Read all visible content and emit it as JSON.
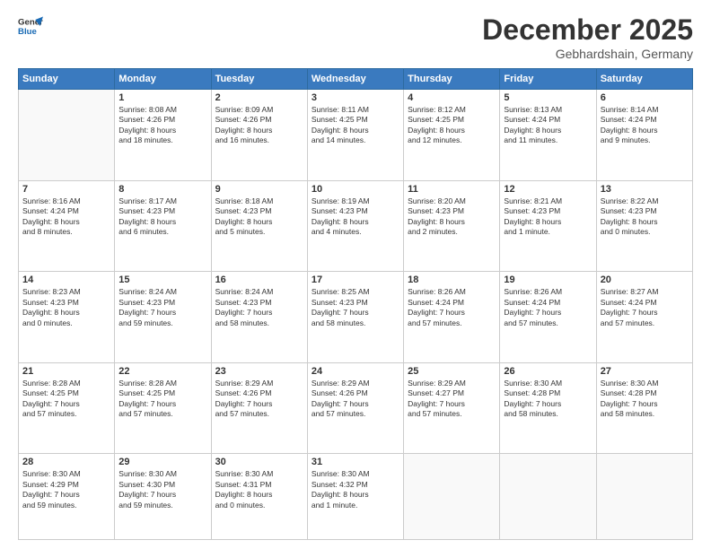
{
  "header": {
    "logo_line1": "General",
    "logo_line2": "Blue",
    "month": "December 2025",
    "location": "Gebhardshain, Germany"
  },
  "weekdays": [
    "Sunday",
    "Monday",
    "Tuesday",
    "Wednesday",
    "Thursday",
    "Friday",
    "Saturday"
  ],
  "weeks": [
    [
      {
        "day": "",
        "info": ""
      },
      {
        "day": "1",
        "info": "Sunrise: 8:08 AM\nSunset: 4:26 PM\nDaylight: 8 hours\nand 18 minutes."
      },
      {
        "day": "2",
        "info": "Sunrise: 8:09 AM\nSunset: 4:26 PM\nDaylight: 8 hours\nand 16 minutes."
      },
      {
        "day": "3",
        "info": "Sunrise: 8:11 AM\nSunset: 4:25 PM\nDaylight: 8 hours\nand 14 minutes."
      },
      {
        "day": "4",
        "info": "Sunrise: 8:12 AM\nSunset: 4:25 PM\nDaylight: 8 hours\nand 12 minutes."
      },
      {
        "day": "5",
        "info": "Sunrise: 8:13 AM\nSunset: 4:24 PM\nDaylight: 8 hours\nand 11 minutes."
      },
      {
        "day": "6",
        "info": "Sunrise: 8:14 AM\nSunset: 4:24 PM\nDaylight: 8 hours\nand 9 minutes."
      }
    ],
    [
      {
        "day": "7",
        "info": "Sunrise: 8:16 AM\nSunset: 4:24 PM\nDaylight: 8 hours\nand 8 minutes."
      },
      {
        "day": "8",
        "info": "Sunrise: 8:17 AM\nSunset: 4:23 PM\nDaylight: 8 hours\nand 6 minutes."
      },
      {
        "day": "9",
        "info": "Sunrise: 8:18 AM\nSunset: 4:23 PM\nDaylight: 8 hours\nand 5 minutes."
      },
      {
        "day": "10",
        "info": "Sunrise: 8:19 AM\nSunset: 4:23 PM\nDaylight: 8 hours\nand 4 minutes."
      },
      {
        "day": "11",
        "info": "Sunrise: 8:20 AM\nSunset: 4:23 PM\nDaylight: 8 hours\nand 2 minutes."
      },
      {
        "day": "12",
        "info": "Sunrise: 8:21 AM\nSunset: 4:23 PM\nDaylight: 8 hours\nand 1 minute."
      },
      {
        "day": "13",
        "info": "Sunrise: 8:22 AM\nSunset: 4:23 PM\nDaylight: 8 hours\nand 0 minutes."
      }
    ],
    [
      {
        "day": "14",
        "info": "Sunrise: 8:23 AM\nSunset: 4:23 PM\nDaylight: 8 hours\nand 0 minutes."
      },
      {
        "day": "15",
        "info": "Sunrise: 8:24 AM\nSunset: 4:23 PM\nDaylight: 7 hours\nand 59 minutes."
      },
      {
        "day": "16",
        "info": "Sunrise: 8:24 AM\nSunset: 4:23 PM\nDaylight: 7 hours\nand 58 minutes."
      },
      {
        "day": "17",
        "info": "Sunrise: 8:25 AM\nSunset: 4:23 PM\nDaylight: 7 hours\nand 58 minutes."
      },
      {
        "day": "18",
        "info": "Sunrise: 8:26 AM\nSunset: 4:24 PM\nDaylight: 7 hours\nand 57 minutes."
      },
      {
        "day": "19",
        "info": "Sunrise: 8:26 AM\nSunset: 4:24 PM\nDaylight: 7 hours\nand 57 minutes."
      },
      {
        "day": "20",
        "info": "Sunrise: 8:27 AM\nSunset: 4:24 PM\nDaylight: 7 hours\nand 57 minutes."
      }
    ],
    [
      {
        "day": "21",
        "info": "Sunrise: 8:28 AM\nSunset: 4:25 PM\nDaylight: 7 hours\nand 57 minutes."
      },
      {
        "day": "22",
        "info": "Sunrise: 8:28 AM\nSunset: 4:25 PM\nDaylight: 7 hours\nand 57 minutes."
      },
      {
        "day": "23",
        "info": "Sunrise: 8:29 AM\nSunset: 4:26 PM\nDaylight: 7 hours\nand 57 minutes."
      },
      {
        "day": "24",
        "info": "Sunrise: 8:29 AM\nSunset: 4:26 PM\nDaylight: 7 hours\nand 57 minutes."
      },
      {
        "day": "25",
        "info": "Sunrise: 8:29 AM\nSunset: 4:27 PM\nDaylight: 7 hours\nand 57 minutes."
      },
      {
        "day": "26",
        "info": "Sunrise: 8:30 AM\nSunset: 4:28 PM\nDaylight: 7 hours\nand 58 minutes."
      },
      {
        "day": "27",
        "info": "Sunrise: 8:30 AM\nSunset: 4:28 PM\nDaylight: 7 hours\nand 58 minutes."
      }
    ],
    [
      {
        "day": "28",
        "info": "Sunrise: 8:30 AM\nSunset: 4:29 PM\nDaylight: 7 hours\nand 59 minutes."
      },
      {
        "day": "29",
        "info": "Sunrise: 8:30 AM\nSunset: 4:30 PM\nDaylight: 7 hours\nand 59 minutes."
      },
      {
        "day": "30",
        "info": "Sunrise: 8:30 AM\nSunset: 4:31 PM\nDaylight: 8 hours\nand 0 minutes."
      },
      {
        "day": "31",
        "info": "Sunrise: 8:30 AM\nSunset: 4:32 PM\nDaylight: 8 hours\nand 1 minute."
      },
      {
        "day": "",
        "info": ""
      },
      {
        "day": "",
        "info": ""
      },
      {
        "day": "",
        "info": ""
      }
    ]
  ]
}
